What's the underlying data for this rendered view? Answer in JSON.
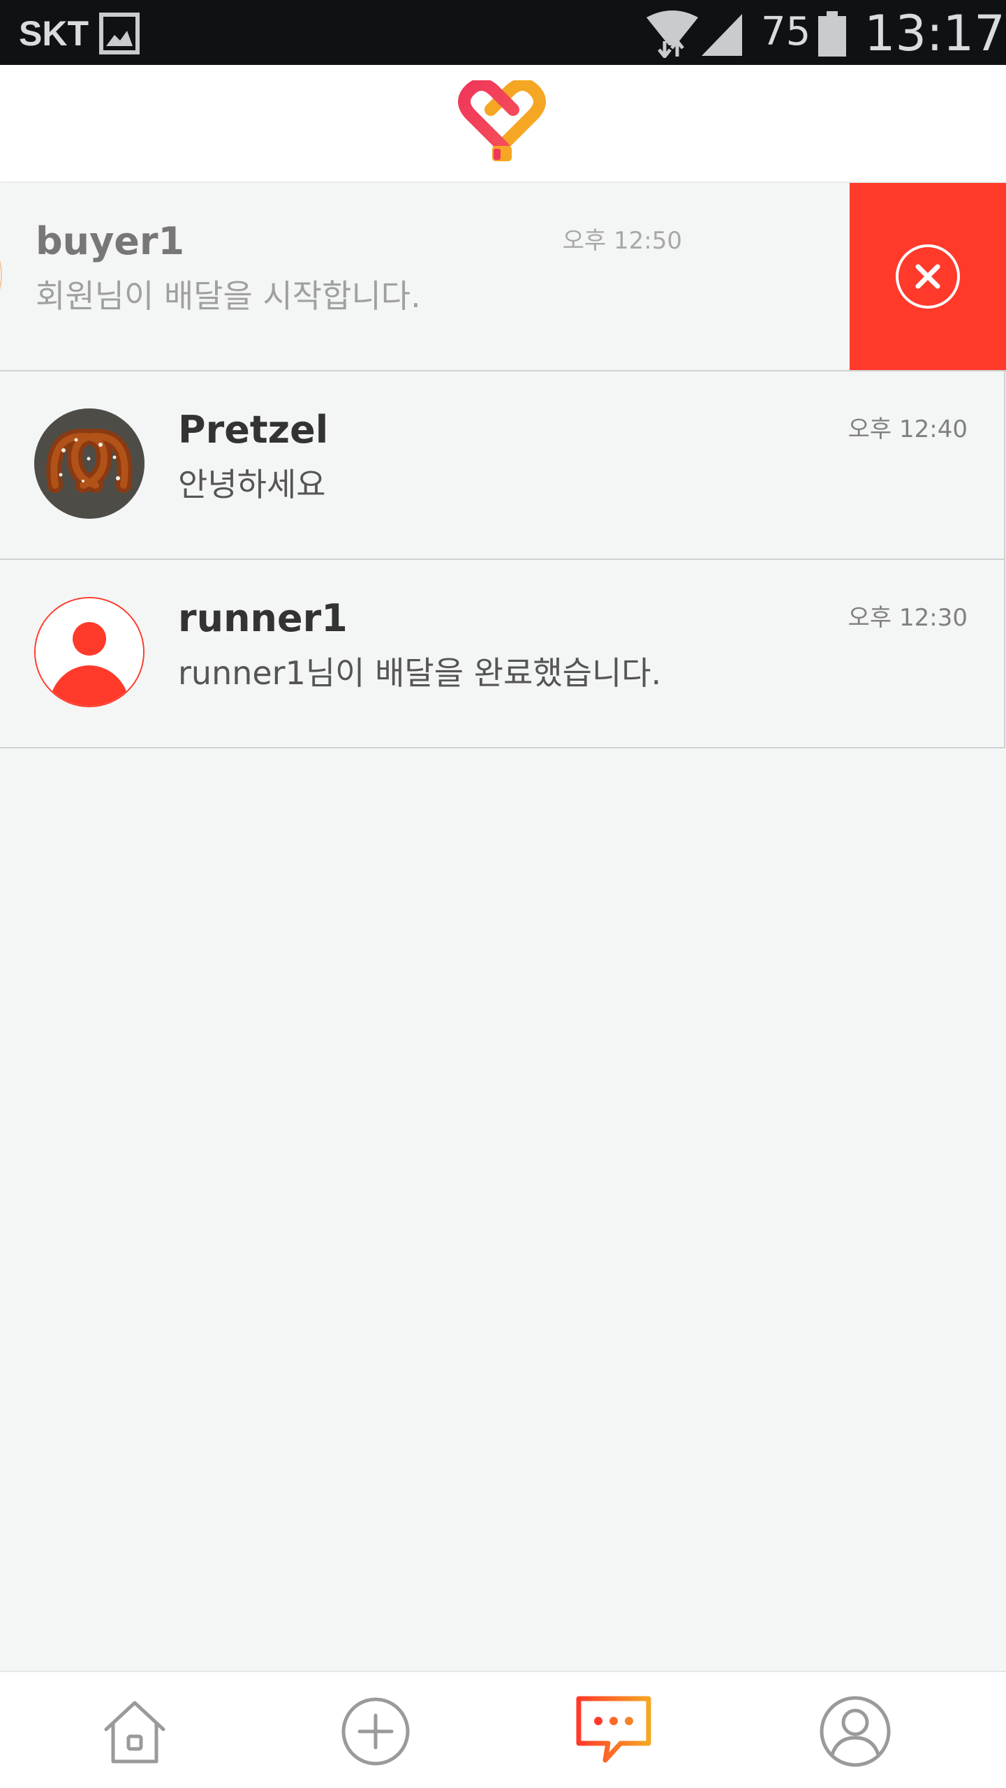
{
  "status_bar": {
    "carrier": "SKT",
    "battery_level": "75",
    "time": "13:17",
    "icons": [
      "gallery-icon",
      "wifi-icon",
      "signal-icon",
      "battery-icon"
    ]
  },
  "header": {
    "logo": "heart-logo-icon"
  },
  "colors": {
    "accent_red": "#ff3a2b",
    "accent_orange": "#f5a623",
    "brand_pink": "#f0365a",
    "background": "#f4f5f5"
  },
  "chats": [
    {
      "name": "buyer1",
      "time": "오후 12:50",
      "preview": "회원님이 배달을 시작합니다.",
      "avatar": "default-user-avatar",
      "swiped": true,
      "action_icon": "close-circle-icon"
    },
    {
      "name": "Pretzel",
      "time": "오후 12:40",
      "preview": "안녕하세요",
      "avatar": "pretzel-photo-avatar",
      "swiped": false
    },
    {
      "name": "runner1",
      "time": "오후 12:30",
      "preview": "runner1님이 배달을 완료했습니다.",
      "avatar": "default-user-avatar",
      "swiped": false
    }
  ],
  "bottom_nav": {
    "items": [
      {
        "icon": "home-icon",
        "active": false
      },
      {
        "icon": "add-circle-icon",
        "active": false
      },
      {
        "icon": "chat-bubble-icon",
        "active": true
      },
      {
        "icon": "profile-icon",
        "active": false
      }
    ]
  }
}
